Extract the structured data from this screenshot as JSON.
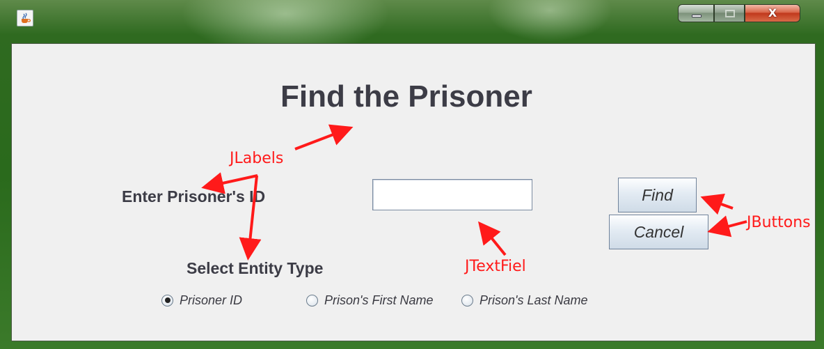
{
  "window": {
    "icon": "java-cup-icon",
    "caption_buttons": {
      "minimize_icon": "minimize-icon",
      "maximize_icon": "maximize-icon",
      "close_glyph": "X"
    },
    "frame_color": "#2f6a20"
  },
  "form": {
    "title": "Find the Prisoner",
    "id_label": "Enter Prisoner's ID",
    "id_value": "",
    "entity_label": "Select Entity Type",
    "buttons": {
      "find": "Find",
      "cancel": "Cancel"
    },
    "radio_options": [
      {
        "label": "Prisoner  ID",
        "selected": true
      },
      {
        "label": "Prison's First Name",
        "selected": false
      },
      {
        "label": "Prison's Last Name",
        "selected": false
      }
    ]
  },
  "annotations": {
    "jlabels": "JLabels",
    "jtextfield": "JTextFiel",
    "jbuttons": "JButtons",
    "color": "#ff1a1a"
  }
}
